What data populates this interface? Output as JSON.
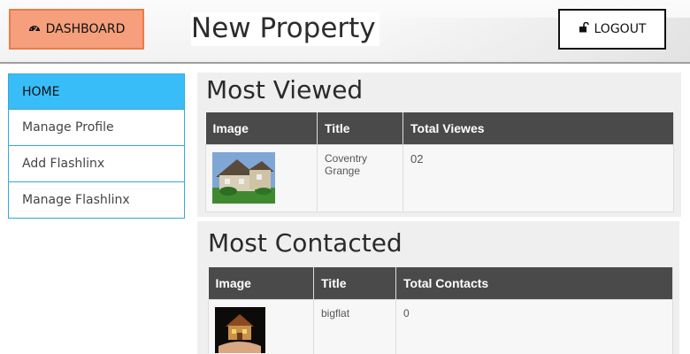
{
  "header": {
    "dashboard_label": "DASHBOARD",
    "page_title": "New Property",
    "logout_label": "LOGOUT"
  },
  "sidebar": {
    "items": [
      {
        "label": "HOME",
        "active": true
      },
      {
        "label": "Manage Profile",
        "active": false
      },
      {
        "label": "Add Flashlinx",
        "active": false
      },
      {
        "label": "Manage Flashlinx",
        "active": false
      }
    ]
  },
  "most_viewed": {
    "title": "Most Viewed",
    "columns": [
      "Image",
      "Title",
      "Total Viewes"
    ],
    "rows": [
      {
        "title": "Coventry Grange",
        "total": "02"
      }
    ]
  },
  "most_contacted": {
    "title": "Most Contacted",
    "columns": [
      "Image",
      "Title",
      "Total Contacts"
    ],
    "rows": [
      {
        "title": "bigflat",
        "total": "0"
      }
    ]
  },
  "colors": {
    "dashboard_bg": "#f59f7c",
    "dashboard_border": "#ef7a45",
    "sidebar_active": "#38bdf8",
    "sidebar_border": "#35a9d9",
    "table_header": "#4a4a4a"
  },
  "icons": {
    "dashboard": "dashboard-icon",
    "logout": "unlock-icon"
  }
}
